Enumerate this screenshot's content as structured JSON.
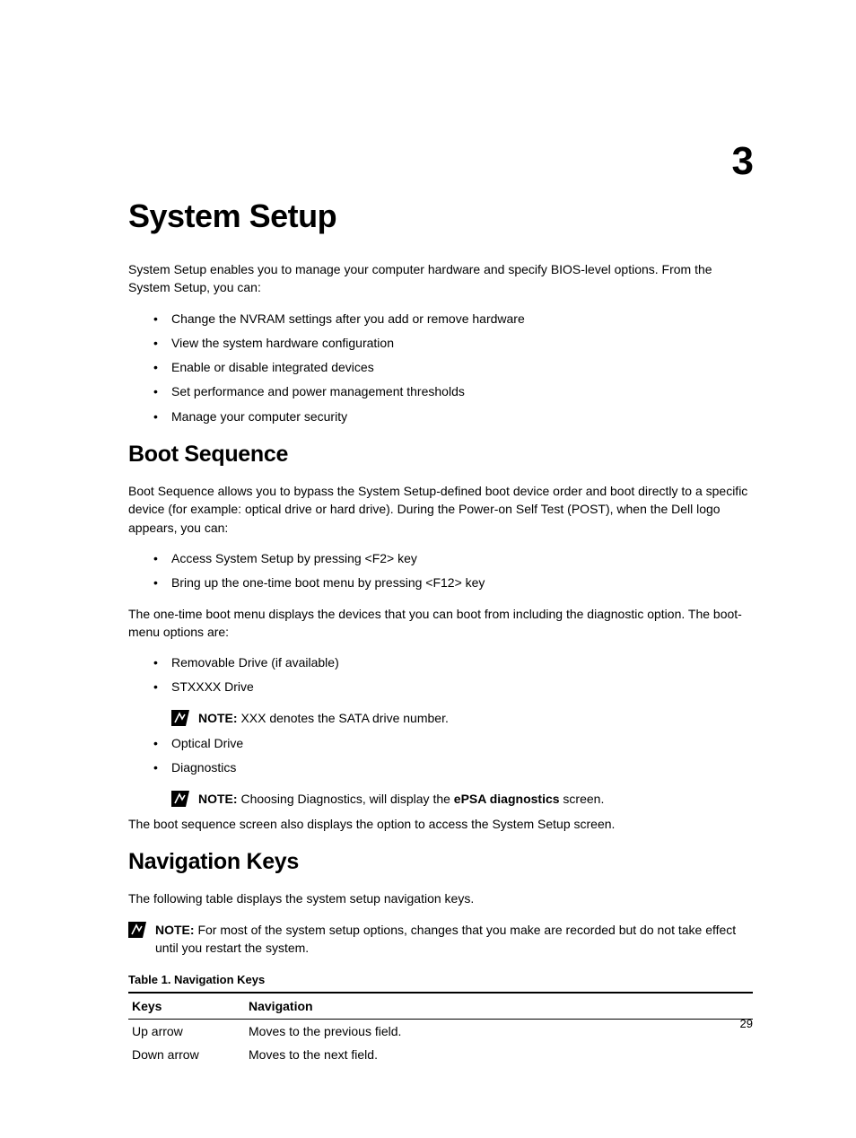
{
  "chapter_number": "3",
  "title": "System Setup",
  "intro": "System Setup enables you to manage your computer hardware and specify BIOS-level options. From the System Setup, you can:",
  "intro_bullets": [
    "Change the NVRAM settings after you add or remove hardware",
    "View the system hardware configuration",
    "Enable or disable integrated devices",
    "Set performance and power management thresholds",
    "Manage your computer security"
  ],
  "section1": {
    "heading": "Boot Sequence",
    "p1": "Boot Sequence allows you to bypass the System Setup-defined boot device order and boot directly to a specific device (for example: optical drive or hard drive). During the Power-on Self Test (POST), when the Dell logo appears, you can:",
    "bullets1": [
      "Access System Setup by pressing <F2> key",
      "Bring up the one-time boot menu by pressing <F12> key"
    ],
    "p2": "The one-time boot menu displays the devices that you can boot from including the diagnostic option. The boot-menu options are:",
    "b2_item1": "Removable Drive (if available)",
    "b2_item2": "STXXXX Drive",
    "note1_label": "NOTE: ",
    "note1_text": "XXX denotes the SATA drive number.",
    "b2_item3": "Optical Drive",
    "b2_item4": "Diagnostics",
    "note2_label": "NOTE: ",
    "note2_pre": "Choosing Diagnostics, will display the ",
    "note2_bold": "ePSA diagnostics",
    "note2_post": " screen.",
    "p3": "The boot sequence screen also displays the option to access the System Setup screen."
  },
  "section2": {
    "heading": "Navigation Keys",
    "p1": "The following table displays the system setup navigation keys.",
    "note_label": "NOTE: ",
    "note_text": "For most of the system setup options, changes that you make are recorded but do not take effect until you restart the system.",
    "table_caption": "Table 1. Navigation Keys",
    "col1": "Keys",
    "col2": "Navigation",
    "rows": [
      {
        "k": "Up arrow",
        "n": "Moves to the previous field."
      },
      {
        "k": "Down arrow",
        "n": "Moves to the next field."
      }
    ]
  },
  "page_number": "29"
}
